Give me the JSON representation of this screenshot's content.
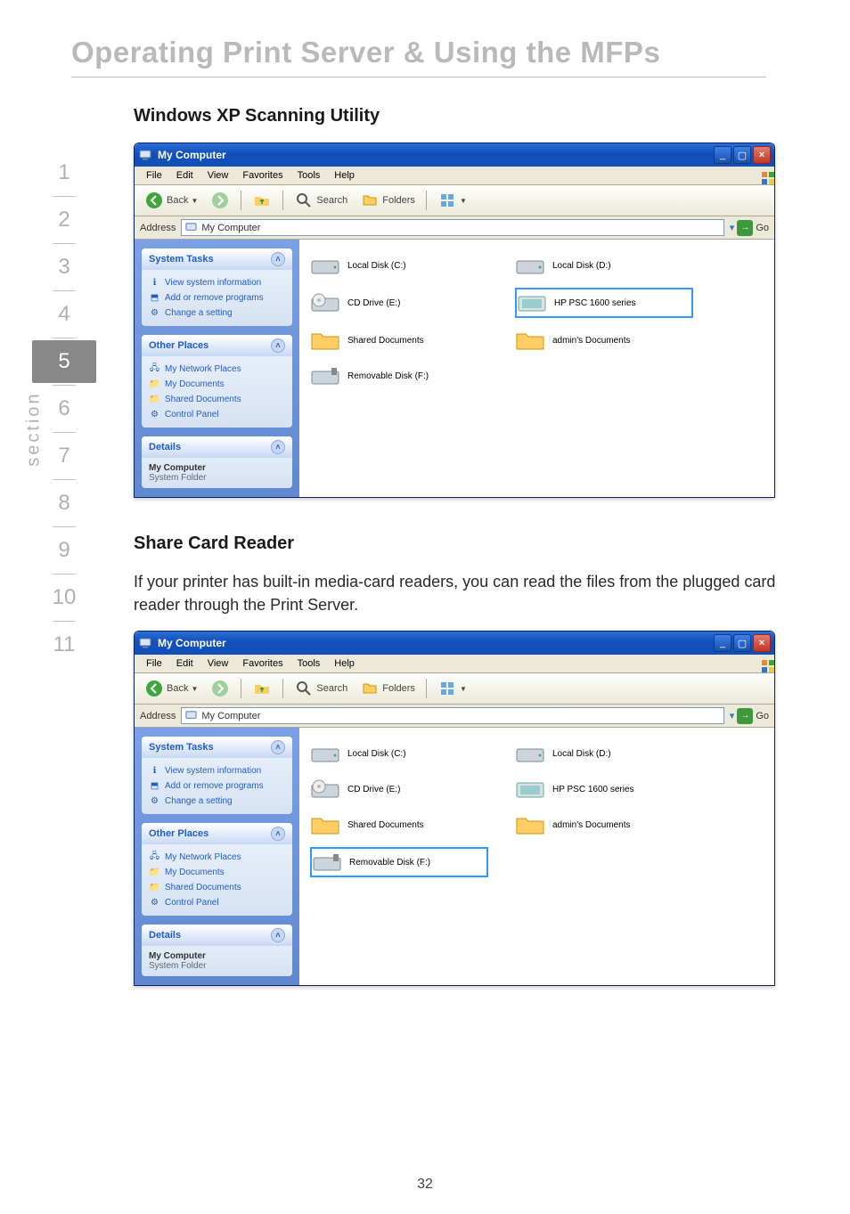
{
  "page": {
    "title": "Operating Print Server & Using the MFPs",
    "number": "32",
    "section_label": "section"
  },
  "nav": {
    "items": [
      "1",
      "2",
      "3",
      "4",
      "5",
      "6",
      "7",
      "8",
      "9",
      "10",
      "11"
    ],
    "active": "5"
  },
  "section1": {
    "heading": "Windows XP Scanning Utility"
  },
  "section2": {
    "heading": "Share Card Reader",
    "body": "If your printer has built-in media-card readers, you can read the files from the plugged card reader through the Print Server."
  },
  "xp": {
    "title": "My Computer",
    "menu": [
      "File",
      "Edit",
      "View",
      "Favorites",
      "Tools",
      "Help"
    ],
    "toolbar": {
      "back": "Back",
      "search": "Search",
      "folders": "Folders"
    },
    "address": {
      "label": "Address",
      "value": "My Computer",
      "go": "Go"
    },
    "panel_tasks": {
      "title": "System Tasks",
      "links": [
        "View system information",
        "Add or remove programs",
        "Change a setting"
      ]
    },
    "panel_places": {
      "title": "Other Places",
      "links": [
        "My Network Places",
        "My Documents",
        "Shared Documents",
        "Control Panel"
      ]
    },
    "panel_details": {
      "title": "Details",
      "name": "My Computer",
      "sub": "System Folder"
    },
    "drives": {
      "c": "Local Disk (C:)",
      "d": "Local Disk (D:)",
      "e": "CD Drive (E:)",
      "hp": "HP PSC 1600 series",
      "shared": "Shared Documents",
      "admin": "admin's Documents",
      "removable": "Removable Disk (F:)"
    }
  }
}
